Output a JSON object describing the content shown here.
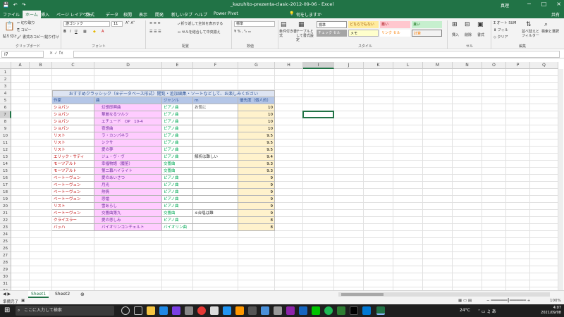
{
  "window": {
    "title": "_kazuhito-prezenta-clasic-2012-09-06 - Excel",
    "search_hint": "何をしますか",
    "user": "真理"
  },
  "ribbon_tabs": [
    "ファイル",
    "ホーム",
    "挿入",
    "ページ レイアウト",
    "数式",
    "データ",
    "校閲",
    "表示",
    "開発",
    "新しいタブ",
    "ヘルプ",
    "Power Pivot"
  ],
  "share_label": "共有",
  "ribbon": {
    "clipboard": {
      "paste": "貼り付け",
      "cut": "切り取り",
      "copy": "コピー",
      "format_painter": "書式のコピー/貼り付け",
      "label": "クリップボード"
    },
    "font": {
      "name": "游ゴシック",
      "size": "11",
      "label": "フォント"
    },
    "alignment": {
      "wrap": "折り返して全体を表示する",
      "merge": "セルを結合して中央揃え",
      "label": "配置"
    },
    "number": {
      "format": "標準",
      "label": "数値"
    },
    "styles": {
      "conditional": "条件付き書式",
      "table": "テーブルとして書式設定",
      "cells": [
        "標準",
        "どちらでもない",
        "悪い",
        "良い",
        "チェック セル",
        "メモ",
        "リンク セル",
        "計算"
      ],
      "label": "スタイル"
    },
    "cells_group": {
      "insert": "挿入",
      "delete": "削除",
      "format": "書式",
      "label": "セル"
    },
    "editing": {
      "autosum": "オート SUM",
      "fill": "フィル",
      "clear": "クリア",
      "sort": "並べ替えとフィルター",
      "find": "検索と選択",
      "label": "編集"
    }
  },
  "formula_bar": {
    "name_box": "I7",
    "formula": ""
  },
  "columns": [
    "A",
    "B",
    "C",
    "D",
    "E",
    "F",
    "G",
    "H",
    "I",
    "J",
    "K",
    "L",
    "M",
    "N",
    "O",
    "P",
    "Q"
  ],
  "rows": [
    "1",
    "2",
    "3",
    "4",
    "5",
    "6",
    "7",
    "8",
    "9",
    "10",
    "11",
    "12",
    "13",
    "14",
    "15",
    "16",
    "17",
    "18",
    "19",
    "20",
    "21",
    "22",
    "23",
    "24",
    "25",
    "26",
    "27",
    "28",
    "29",
    "30",
    "31",
    "32"
  ],
  "table": {
    "title": "おすすめクラッシック（※データベース形式）閲覧・追加編集・ソートなどして、お楽しみください",
    "headers": [
      "作家",
      "曲",
      "ジャンル",
      "ｍ",
      "優先度（個人的）"
    ],
    "rows": [
      {
        "composer": "ショパン",
        "piece": "幻想即興曲",
        "genre": "ピアノ曲",
        "note": "お気に",
        "score": "10"
      },
      {
        "composer": "ショパン",
        "piece": "華麗なるワルツ",
        "genre": "ピアノ曲",
        "note": "",
        "score": "10"
      },
      {
        "composer": "ショパン",
        "piece": "エチュード　OP　10-4",
        "genre": "ピアノ曲",
        "note": "",
        "score": "10"
      },
      {
        "composer": "ショパン",
        "piece": "夜想曲",
        "genre": "ピアノ曲",
        "note": "",
        "score": "10"
      },
      {
        "composer": "リスト",
        "piece": "ラ・カンパネラ",
        "genre": "ピアノ曲",
        "note": "",
        "score": "9.5"
      },
      {
        "composer": "リスト",
        "piece": "シクサ",
        "genre": "ピアノ曲",
        "note": "",
        "score": "9.5"
      },
      {
        "composer": "リスト",
        "piece": "愛の夢",
        "genre": "ピアノ曲",
        "note": "",
        "score": "9.5"
      },
      {
        "composer": "エリック・サティ",
        "piece": "ジュ・ヴ・ヴ",
        "genre": "ピアノ曲",
        "note": "解析は難しい",
        "score": "9.4"
      },
      {
        "composer": "モーツアルト",
        "piece": "幸福物語（魔笛）",
        "genre": "交響曲",
        "note": "",
        "score": "9.3"
      },
      {
        "composer": "モーツアルト",
        "piece": "第二幕ハイライト",
        "genre": "交響曲",
        "note": "",
        "score": "9.3"
      },
      {
        "composer": "ベートーヴェン",
        "piece": "愛のあいさつ",
        "genre": "ピアノ曲",
        "note": "",
        "score": "9"
      },
      {
        "composer": "ベートーヴェン",
        "piece": "月光",
        "genre": "ピアノ曲",
        "note": "",
        "score": "9"
      },
      {
        "composer": "ベートーヴェン",
        "piece": "熱情",
        "genre": "ピアノ曲",
        "note": "",
        "score": "9"
      },
      {
        "composer": "ベートーヴェン",
        "piece": "悲愴",
        "genre": "ピアノ曲",
        "note": "",
        "score": "9"
      },
      {
        "composer": "リスト",
        "piece": "雪あらし",
        "genre": "ピアノ曲",
        "note": "",
        "score": "9"
      },
      {
        "composer": "ベートーヴェン",
        "piece": "交響曲第九",
        "genre": "交響曲",
        "note": "※合唱は難",
        "score": "9"
      },
      {
        "composer": "クライスラー",
        "piece": "愛の悲しみ",
        "genre": "ピアノ曲",
        "note": "",
        "score": "8"
      },
      {
        "composer": "バッハ",
        "piece": "バイオリンコンチェルト",
        "genre": "バイオリン曲",
        "note": "",
        "score": "8"
      }
    ]
  },
  "sheets": [
    "Sheet1",
    "Sheet2"
  ],
  "status": {
    "ready": "準備完了",
    "zoom": "100%"
  },
  "taskbar": {
    "search": "ここに入力して検索",
    "temp": "24°C",
    "time": "4:07",
    "date": "2021/09/08"
  }
}
